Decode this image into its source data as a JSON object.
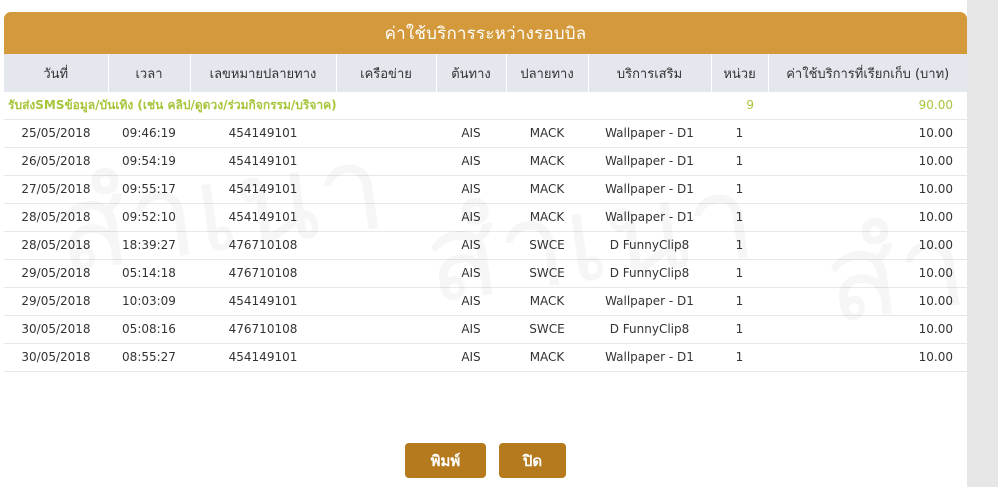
{
  "watermark": "สำเนา",
  "title": "ค่าใช้บริการระหว่างรอบบิล",
  "columns": [
    "วันที่",
    "เวลา",
    "เลขหมายปลายทาง",
    "เครือข่าย",
    "ต้นทาง",
    "ปลายทาง",
    "บริการเสริม",
    "หน่วย",
    "ค่าใช้บริการที่เรียกเก็บ (บาท)"
  ],
  "group": {
    "label": "รับส่งSMSข้อมูล/บันเทิง (เช่น คลิป/ดูดวง/ร่วมกิจกรรม/บริจาค)",
    "units": "9",
    "total": "90.00"
  },
  "rows": [
    {
      "date": "25/05/2018",
      "time": "09:46:19",
      "dest_number": "454149101",
      "network": "",
      "origin": "AIS",
      "destination": "MACK",
      "service": "Wallpaper - D1",
      "units": "1",
      "charge": "10.00"
    },
    {
      "date": "26/05/2018",
      "time": "09:54:19",
      "dest_number": "454149101",
      "network": "",
      "origin": "AIS",
      "destination": "MACK",
      "service": "Wallpaper - D1",
      "units": "1",
      "charge": "10.00"
    },
    {
      "date": "27/05/2018",
      "time": "09:55:17",
      "dest_number": "454149101",
      "network": "",
      "origin": "AIS",
      "destination": "MACK",
      "service": "Wallpaper - D1",
      "units": "1",
      "charge": "10.00"
    },
    {
      "date": "28/05/2018",
      "time": "09:52:10",
      "dest_number": "454149101",
      "network": "",
      "origin": "AIS",
      "destination": "MACK",
      "service": "Wallpaper - D1",
      "units": "1",
      "charge": "10.00"
    },
    {
      "date": "28/05/2018",
      "time": "18:39:27",
      "dest_number": "476710108",
      "network": "",
      "origin": "AIS",
      "destination": "SWCE",
      "service": "D FunnyClip8",
      "units": "1",
      "charge": "10.00"
    },
    {
      "date": "29/05/2018",
      "time": "05:14:18",
      "dest_number": "476710108",
      "network": "",
      "origin": "AIS",
      "destination": "SWCE",
      "service": "D FunnyClip8",
      "units": "1",
      "charge": "10.00"
    },
    {
      "date": "29/05/2018",
      "time": "10:03:09",
      "dest_number": "454149101",
      "network": "",
      "origin": "AIS",
      "destination": "MACK",
      "service": "Wallpaper - D1",
      "units": "1",
      "charge": "10.00"
    },
    {
      "date": "30/05/2018",
      "time": "05:08:16",
      "dest_number": "476710108",
      "network": "",
      "origin": "AIS",
      "destination": "SWCE",
      "service": "D FunnyClip8",
      "units": "1",
      "charge": "10.00"
    },
    {
      "date": "30/05/2018",
      "time": "08:55:27",
      "dest_number": "454149101",
      "network": "",
      "origin": "AIS",
      "destination": "MACK",
      "service": "Wallpaper - D1",
      "units": "1",
      "charge": "10.00"
    }
  ],
  "buttons": {
    "print": "พิมพ์",
    "close": "ปิด"
  },
  "colors": {
    "header": "#d4993a",
    "button": "#b5791e",
    "group_text": "#a6c53a",
    "table_header": "#e5e7ee"
  }
}
